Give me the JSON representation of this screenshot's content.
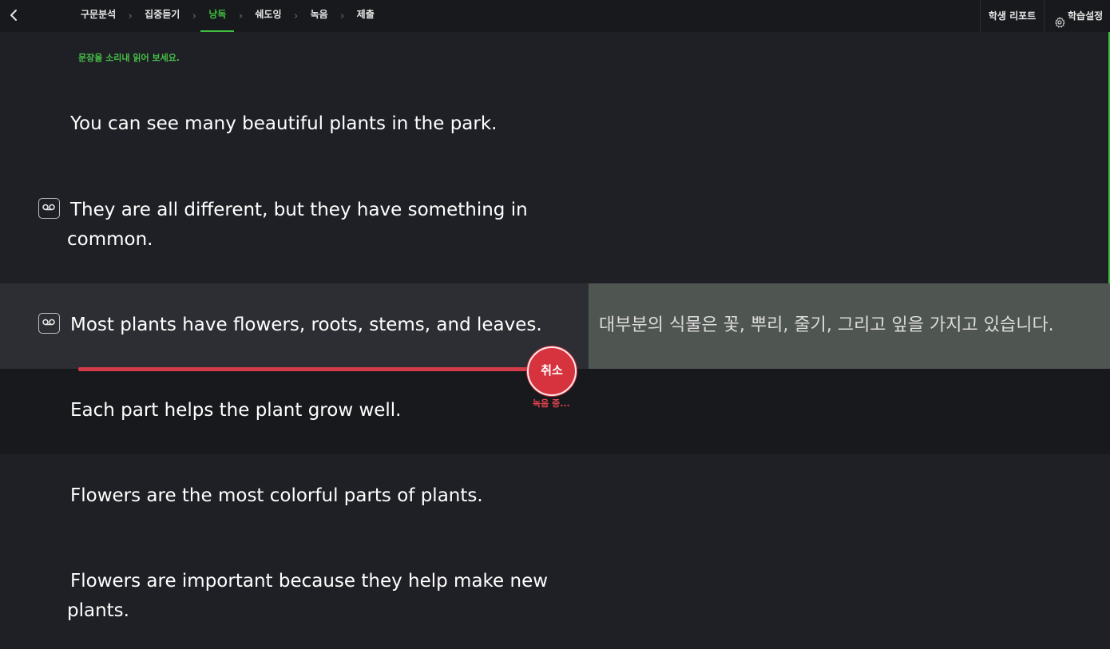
{
  "header": {
    "steps": [
      {
        "label": "구문분석"
      },
      {
        "label": "집중듣기"
      },
      {
        "label": "낭독",
        "active": true
      },
      {
        "label": "쉐도잉"
      },
      {
        "label": "녹음"
      },
      {
        "label": "제출"
      }
    ],
    "separator": "›",
    "report_label": "학생 리포트",
    "settings_label": "학습설정"
  },
  "instruction": "문장을 소리내 읽어 보세요.",
  "sentences": [
    {
      "text": "You can see many beautiful plants in the park."
    },
    {
      "line1": "They are all different, but they have something in",
      "line2": "common."
    },
    {
      "text": "Most plants have flowers, roots, stems, and leaves.",
      "translation": "대부분의 식물은 꽃, 뿌리, 줄기, 그리고 잎을 가지고 있습니다."
    },
    {
      "text": "Each part helps the plant grow well."
    },
    {
      "text": "Flowers are the most colorful parts of plants."
    },
    {
      "line1": "Flowers are important because they help make new",
      "line2": "plants."
    }
  ],
  "recording": {
    "cancel_label": "취소",
    "status": "녹음 중..."
  },
  "colors": {
    "accent_green": "#3fbf3f",
    "record_red": "#d6333f",
    "highlight_row": "#2d2e33",
    "translation_bg": "#4f5551"
  },
  "icons": {
    "back": "chevron-left-icon",
    "voicemail": "voicemail-icon",
    "settings": "gear-icon"
  }
}
